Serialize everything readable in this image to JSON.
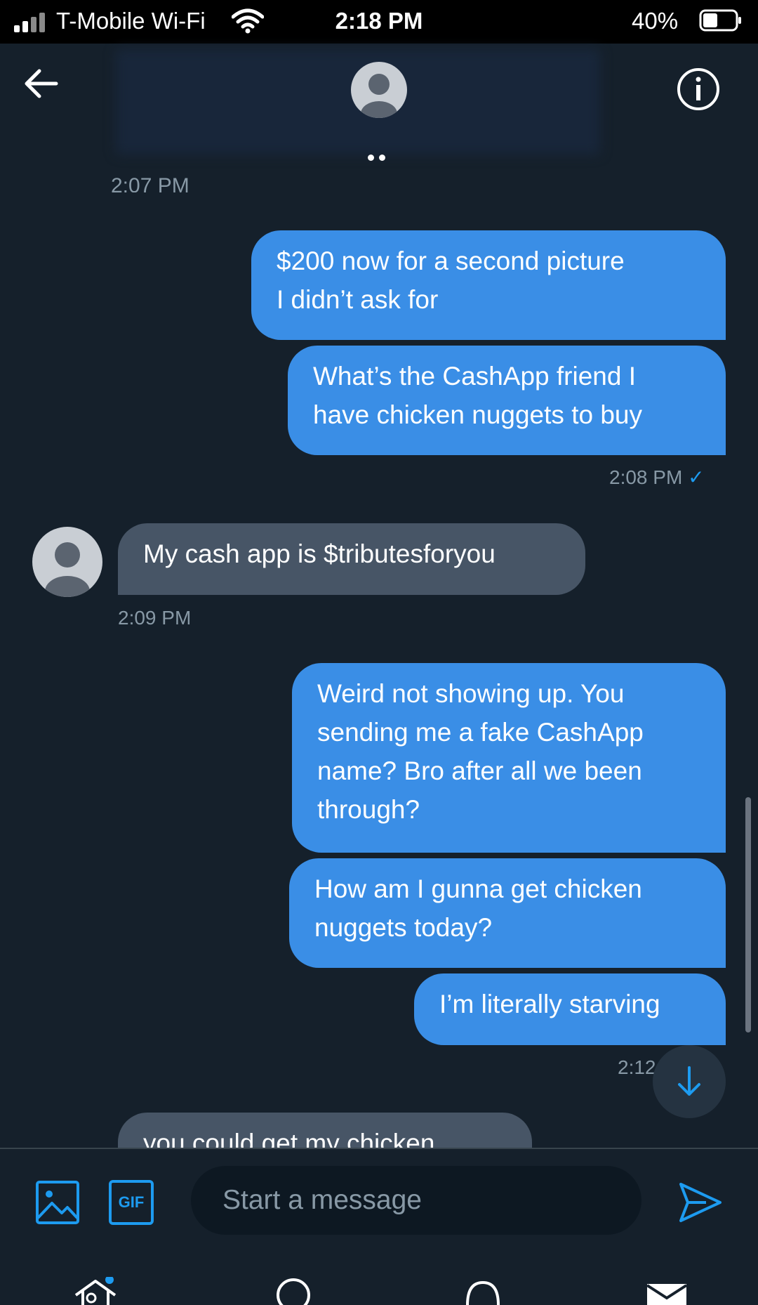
{
  "status_bar": {
    "carrier": "T-Mobile Wi-Fi",
    "time": "2:18 PM",
    "battery": "40%",
    "signal_icon": "cellular-signal-icon",
    "wifi_icon": "wifi-icon",
    "battery_icon": "battery-icon"
  },
  "header": {
    "back_icon": "back-arrow-icon",
    "info_icon": "info-icon",
    "avatar_icon": "default-avatar-icon",
    "cut_off_time": "2:07 PM"
  },
  "messages": [
    {
      "type": "sent",
      "text": [
        "$200 now for a second picture",
        "I didn’t ask for"
      ]
    },
    {
      "type": "sent",
      "text": [
        "What’s the CashApp friend I",
        "have chicken nuggets to buy"
      ]
    },
    {
      "type": "sent_time",
      "time": "2:08 PM"
    },
    {
      "type": "received",
      "text": [
        "My cash app is $tributesforyou"
      ]
    },
    {
      "type": "received_time",
      "time": "2:09 PM"
    },
    {
      "type": "sent",
      "text": [
        "Weird not showing up. You",
        "sending me a fake CashApp",
        "name? Bro after all we been",
        "through?"
      ]
    },
    {
      "type": "sent",
      "text": [
        "How am I gunna get chicken",
        "nuggets today?"
      ]
    },
    {
      "type": "sent",
      "text": [
        "I’m literally starving"
      ]
    },
    {
      "type": "sent_time",
      "time": "2:12"
    },
    {
      "type": "received",
      "text": [
        "you could get my chicken"
      ]
    }
  ],
  "compose": {
    "placeholder": "Start a message",
    "gif_label": "GIF",
    "image_icon": "image-icon",
    "send_icon": "send-icon"
  },
  "scroll_down_icon": "arrow-down-icon",
  "bottom_nav": [
    "home-icon",
    "search-icon",
    "notifications-icon",
    "mail-icon"
  ],
  "colors": {
    "background": "#15202b",
    "sent_bubble": "#3a8ee6",
    "received_bubble": "#475566",
    "accent": "#1d9bf0",
    "muted_text": "#8899a6"
  }
}
